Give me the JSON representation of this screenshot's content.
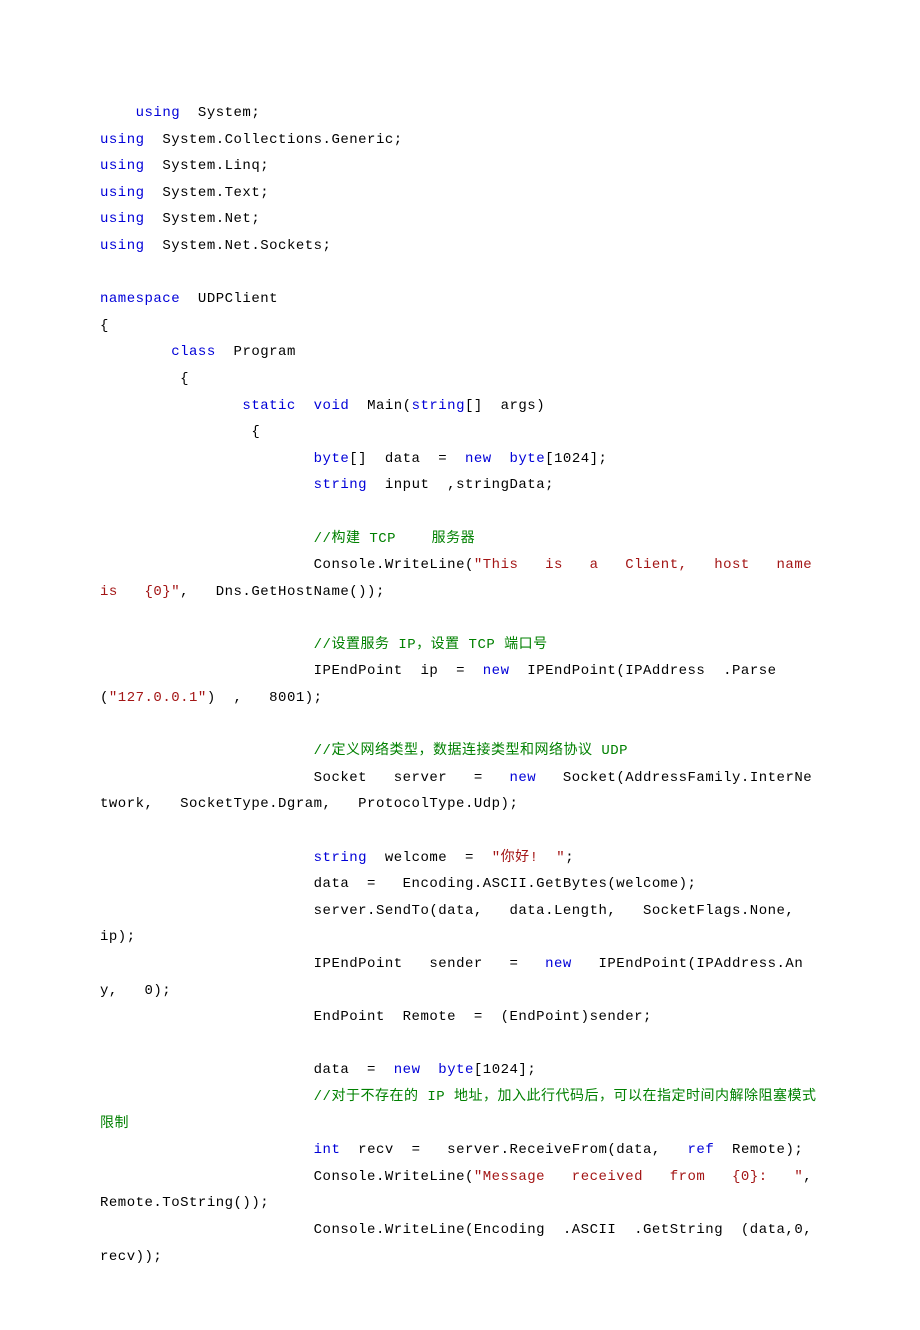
{
  "code_lines": [
    {
      "indent": "    ",
      "tokens": [
        {
          "t": "using",
          "c": "kw"
        },
        {
          "t": "  System;",
          "c": ""
        }
      ]
    },
    {
      "indent": "",
      "tokens": [
        {
          "t": "using",
          "c": "kw"
        },
        {
          "t": "  System.Collections.Generic;",
          "c": ""
        }
      ]
    },
    {
      "indent": "",
      "tokens": [
        {
          "t": "using",
          "c": "kw"
        },
        {
          "t": "  System.Linq;",
          "c": ""
        }
      ]
    },
    {
      "indent": "",
      "tokens": [
        {
          "t": "using",
          "c": "kw"
        },
        {
          "t": "  System.Text;",
          "c": ""
        }
      ]
    },
    {
      "indent": "",
      "tokens": [
        {
          "t": "using",
          "c": "kw"
        },
        {
          "t": "  System.Net;",
          "c": ""
        }
      ]
    },
    {
      "indent": "",
      "tokens": [
        {
          "t": "using",
          "c": "kw"
        },
        {
          "t": "  System.Net.Sockets;",
          "c": ""
        }
      ]
    },
    {
      "indent": "",
      "tokens": [
        {
          "t": "",
          "c": ""
        }
      ]
    },
    {
      "indent": "",
      "tokens": [
        {
          "t": "namespace",
          "c": "kw"
        },
        {
          "t": "  UDPClient",
          "c": ""
        }
      ]
    },
    {
      "indent": "",
      "tokens": [
        {
          "t": "{",
          "c": ""
        }
      ]
    },
    {
      "indent": "        ",
      "tokens": [
        {
          "t": "class",
          "c": "kw"
        },
        {
          "t": "  Program",
          "c": ""
        }
      ]
    },
    {
      "indent": "        ",
      "tokens": [
        {
          "t": " {",
          "c": ""
        }
      ]
    },
    {
      "indent": "                ",
      "tokens": [
        {
          "t": "static",
          "c": "kw"
        },
        {
          "t": "  ",
          "c": ""
        },
        {
          "t": "void",
          "c": "kw"
        },
        {
          "t": "  Main(",
          "c": ""
        },
        {
          "t": "string",
          "c": "kw"
        },
        {
          "t": "[]  args)",
          "c": ""
        }
      ]
    },
    {
      "indent": "                ",
      "tokens": [
        {
          "t": " {",
          "c": ""
        }
      ]
    },
    {
      "indent": "                        ",
      "tokens": [
        {
          "t": "byte",
          "c": "kw"
        },
        {
          "t": "[]  data  =  ",
          "c": ""
        },
        {
          "t": "new",
          "c": "kw"
        },
        {
          "t": "  ",
          "c": ""
        },
        {
          "t": "byte",
          "c": "kw"
        },
        {
          "t": "[1024];",
          "c": ""
        }
      ]
    },
    {
      "indent": "                        ",
      "tokens": [
        {
          "t": "string",
          "c": "kw"
        },
        {
          "t": "  input  ,stringData;",
          "c": ""
        }
      ]
    },
    {
      "indent": "",
      "tokens": [
        {
          "t": "",
          "c": ""
        }
      ]
    },
    {
      "indent": "                        ",
      "tokens": [
        {
          "t": "//构建 TCP    服务器",
          "c": "cm"
        }
      ]
    },
    {
      "indent": "                        ",
      "tokens": [
        {
          "t": "Console.WriteLine(",
          "c": ""
        },
        {
          "t": "\"This   is   a   Client,   host   name   is   {0}\"",
          "c": "str"
        },
        {
          "t": ",   Dns.GetHostName());",
          "c": ""
        }
      ]
    },
    {
      "indent": "",
      "tokens": [
        {
          "t": "",
          "c": ""
        }
      ]
    },
    {
      "indent": "                        ",
      "tokens": [
        {
          "t": "//设置服务 IP，设置 TCP 端口号",
          "c": "cm"
        }
      ]
    },
    {
      "indent": "                        ",
      "tokens": [
        {
          "t": "IPEndPoint  ip  =  ",
          "c": ""
        },
        {
          "t": "new",
          "c": "kw"
        },
        {
          "t": "  IPEndPoint(IPAddress  .Parse  (",
          "c": ""
        },
        {
          "t": "\"127.0.0.1\"",
          "c": "str"
        },
        {
          "t": ")  ,   8001);",
          "c": ""
        }
      ]
    },
    {
      "indent": "",
      "tokens": [
        {
          "t": "",
          "c": ""
        }
      ]
    },
    {
      "indent": "                        ",
      "tokens": [
        {
          "t": "//定义网络类型，数据连接类型和网络协议 UDP",
          "c": "cm"
        }
      ]
    },
    {
      "indent": "                        ",
      "tokens": [
        {
          "t": "Socket   server   =   ",
          "c": ""
        },
        {
          "t": "new",
          "c": "kw"
        },
        {
          "t": "   Socket(AddressFamily.InterNetwork,   SocketType.Dgram,   ProtocolType.Udp);",
          "c": ""
        }
      ]
    },
    {
      "indent": "",
      "tokens": [
        {
          "t": "",
          "c": ""
        }
      ]
    },
    {
      "indent": "                        ",
      "tokens": [
        {
          "t": "string",
          "c": "kw"
        },
        {
          "t": "  welcome  =  ",
          "c": ""
        },
        {
          "t": "\"你好!  \"",
          "c": "str"
        },
        {
          "t": ";",
          "c": ""
        }
      ]
    },
    {
      "indent": "                        ",
      "tokens": [
        {
          "t": "data  =   Encoding.ASCII.GetBytes(welcome);",
          "c": ""
        }
      ]
    },
    {
      "indent": "                        ",
      "tokens": [
        {
          "t": "server.SendTo(data,   data.Length,   SocketFlags.None,   ip);",
          "c": ""
        }
      ]
    },
    {
      "indent": "                        ",
      "tokens": [
        {
          "t": "IPEndPoint   sender   =   ",
          "c": ""
        },
        {
          "t": "new",
          "c": "kw"
        },
        {
          "t": "   IPEndPoint(IPAddress.Any,   0);",
          "c": ""
        }
      ]
    },
    {
      "indent": "                        ",
      "tokens": [
        {
          "t": "EndPoint  Remote  =  (EndPoint)sender;",
          "c": ""
        }
      ]
    },
    {
      "indent": "",
      "tokens": [
        {
          "t": "",
          "c": ""
        }
      ]
    },
    {
      "indent": "                        ",
      "tokens": [
        {
          "t": "data  =  ",
          "c": ""
        },
        {
          "t": "new",
          "c": "kw"
        },
        {
          "t": "  ",
          "c": ""
        },
        {
          "t": "byte",
          "c": "kw"
        },
        {
          "t": "[1024];",
          "c": ""
        }
      ]
    },
    {
      "indent": "                        ",
      "tokens": [
        {
          "t": "//对于不存在的 IP 地址，加入此行代码后，可以在指定时间内解除阻塞模式限制",
          "c": "cm"
        }
      ]
    },
    {
      "indent": "                        ",
      "tokens": [
        {
          "t": "int",
          "c": "kw"
        },
        {
          "t": "  recv  =   server.ReceiveFrom(data,   ",
          "c": ""
        },
        {
          "t": "ref",
          "c": "kw"
        },
        {
          "t": "  Remote);",
          "c": ""
        }
      ]
    },
    {
      "indent": "                        ",
      "tokens": [
        {
          "t": "Console.WriteLine(",
          "c": ""
        },
        {
          "t": "\"Message   received   from   {0}:   \"",
          "c": "str"
        },
        {
          "t": ",   Remote.ToString());",
          "c": ""
        }
      ]
    },
    {
      "indent": "                        ",
      "tokens": [
        {
          "t": "Console.WriteLine(Encoding  .ASCII  .GetString  (data,0,  recv));",
          "c": ""
        }
      ]
    }
  ]
}
